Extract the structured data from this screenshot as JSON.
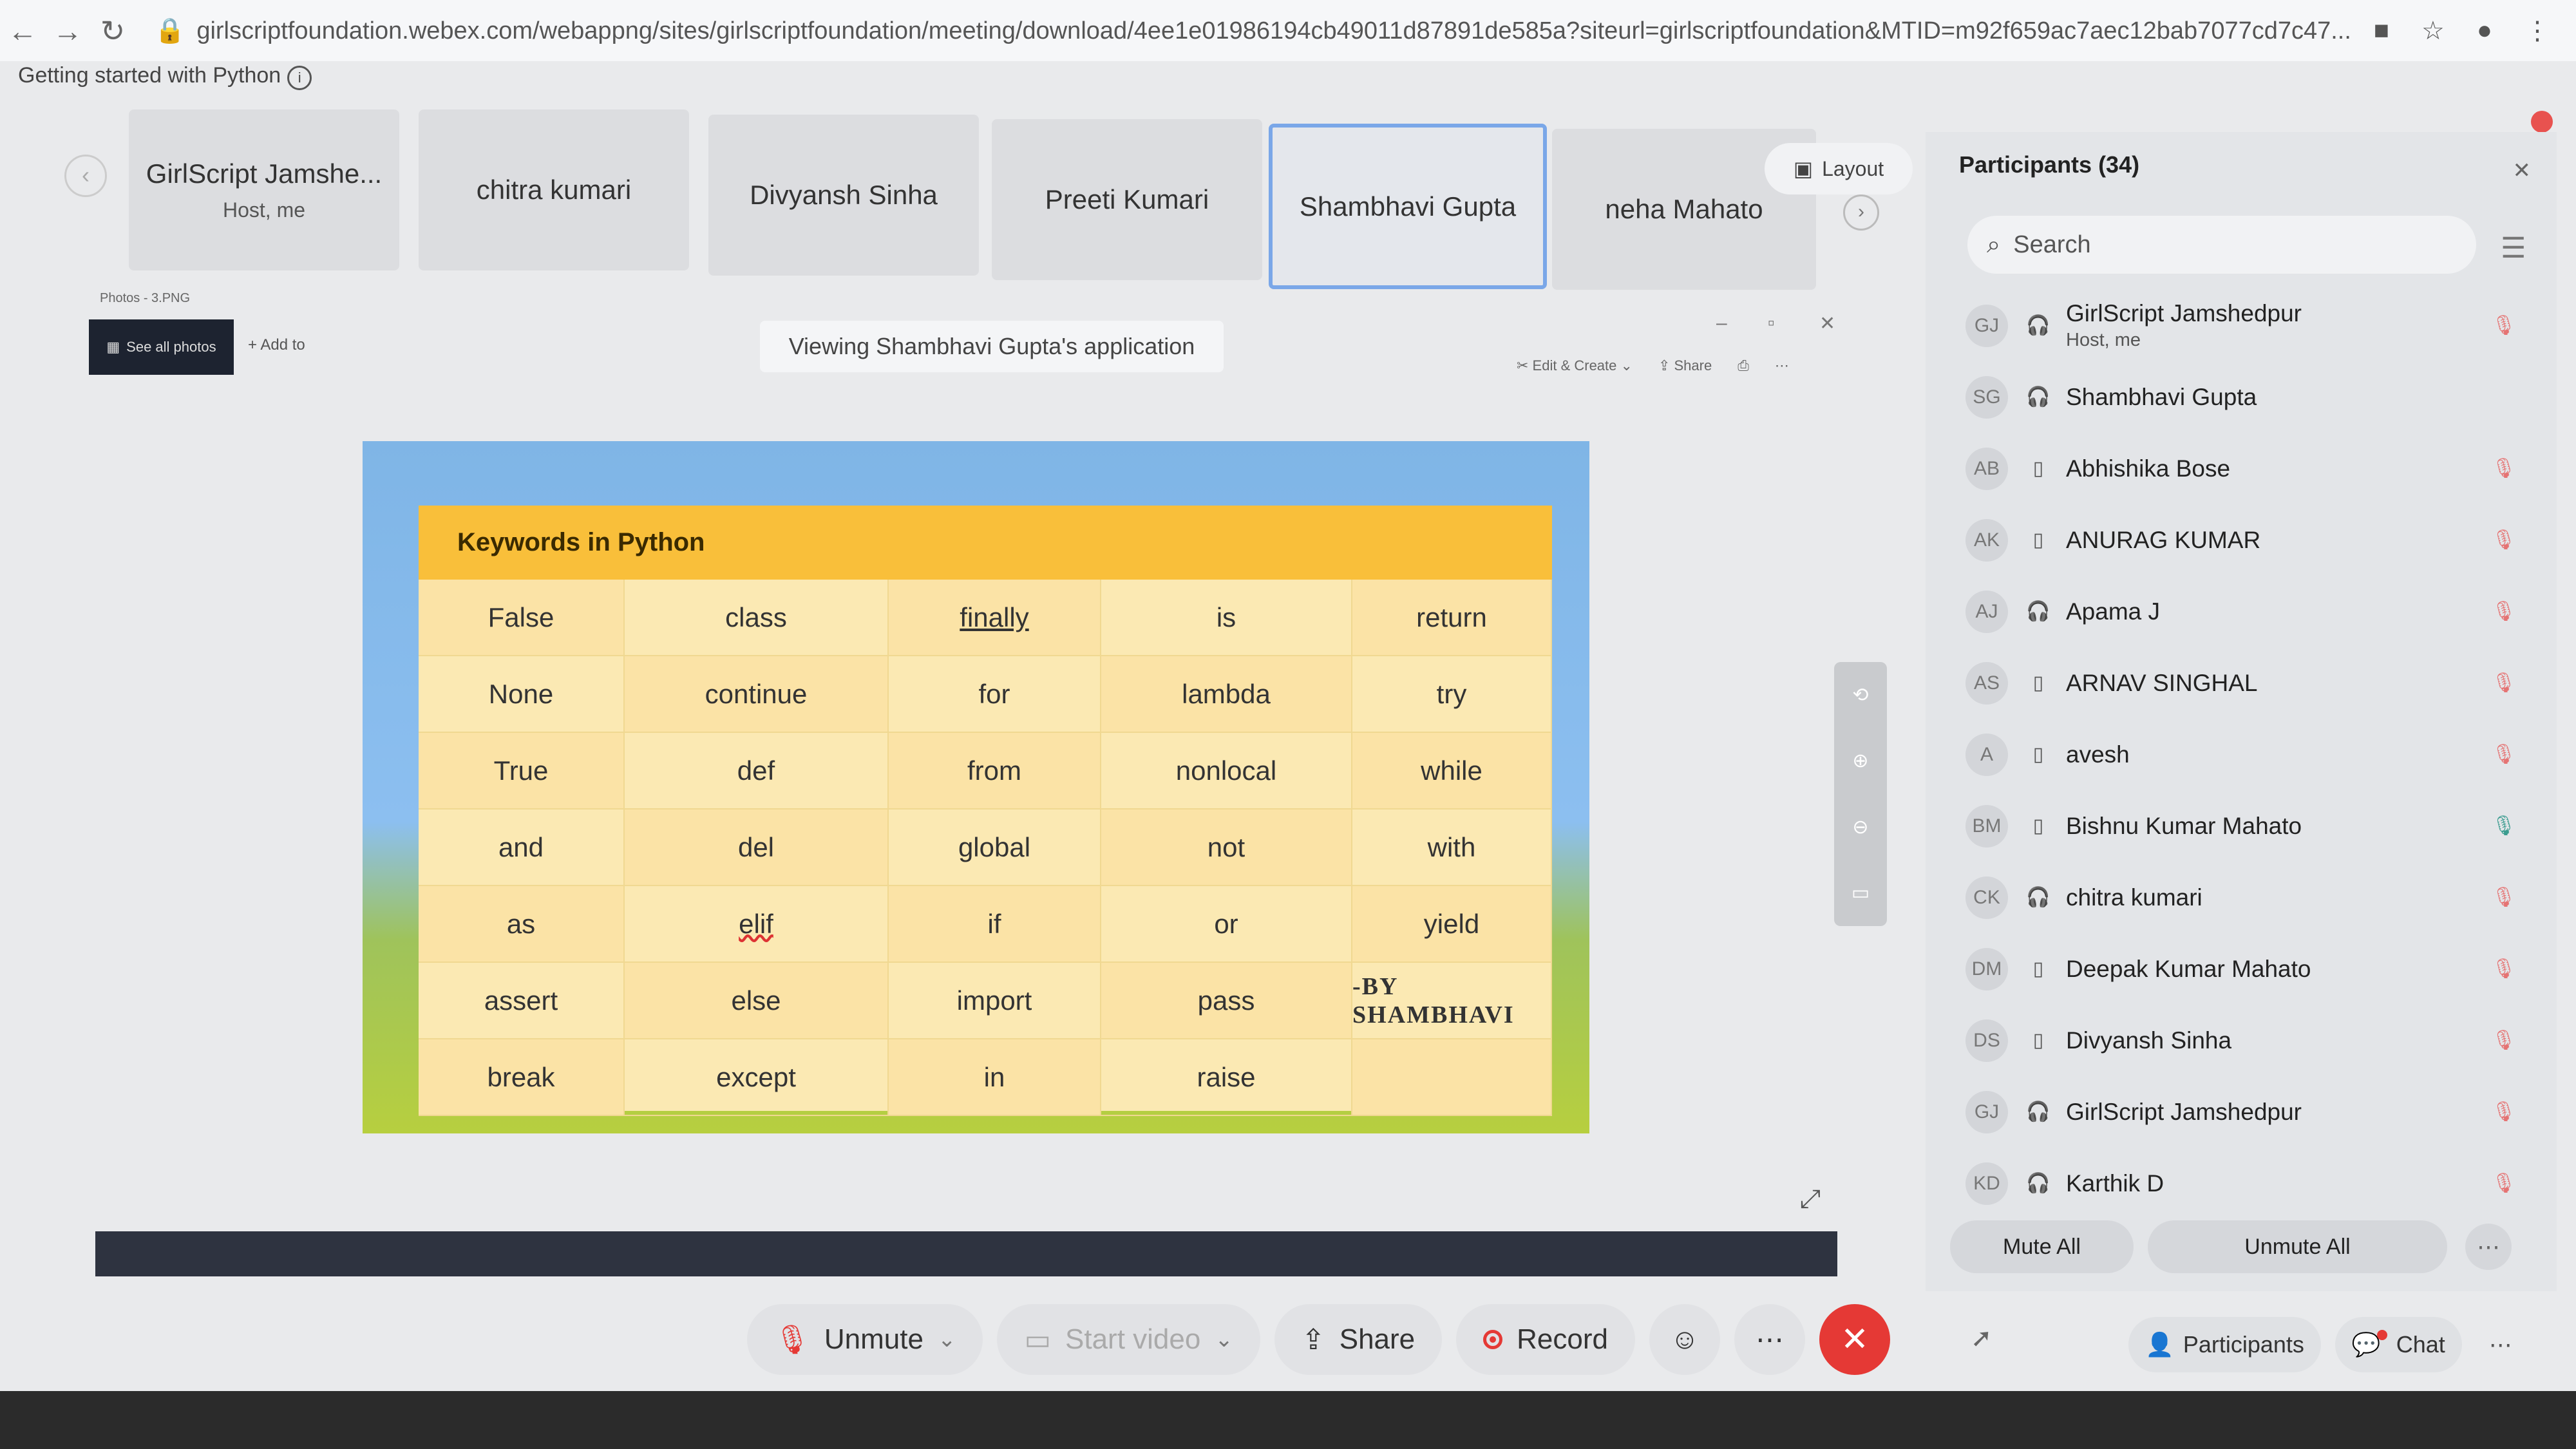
{
  "browser": {
    "url": "girlscriptfoundation.webex.com/webappng/sites/girlscriptfoundation/meeting/download/4ee1e01986194cb49011d87891de585a?siteurl=girlscriptfoundation&MTID=m92f659ac7aec12bab7077cd7c47..."
  },
  "meeting": {
    "title": "Getting started with Python"
  },
  "video_tiles": [
    {
      "name": "GirlScript Jamshe...",
      "sub": "Host, me"
    },
    {
      "name": "chitra kumari",
      "sub": ""
    },
    {
      "name": "Divyansh Sinha",
      "sub": ""
    },
    {
      "name": "Preeti Kumari",
      "sub": ""
    },
    {
      "name": "Shambhavi Gupta",
      "sub": ""
    },
    {
      "name": "neha Mahato",
      "sub": ""
    }
  ],
  "layout_label": "Layout",
  "share": {
    "viewing_label": "Viewing Shambhavi Gupta's application",
    "photos_title": "Photos - 3.PNG",
    "see_all_photos": "See all photos",
    "add_to": "Add to",
    "edit_create": "Edit & Create",
    "share": "Share"
  },
  "keywords_table": {
    "title": "Keywords in Python",
    "rows": [
      [
        "False",
        "class",
        "finally",
        "is",
        "return"
      ],
      [
        "None",
        "continue",
        "for",
        "lambda",
        "try"
      ],
      [
        "True",
        "def",
        "from",
        "nonlocal",
        "while"
      ],
      [
        "and",
        "del",
        "global",
        "not",
        "with"
      ],
      [
        "as",
        "elif",
        "if",
        "or",
        "yield"
      ],
      [
        "assert",
        "else",
        "import",
        "pass",
        "-BY SHAMBHAVI"
      ],
      [
        "break",
        "except",
        "in",
        "raise",
        ""
      ]
    ]
  },
  "controls": {
    "unmute": "Unmute",
    "start_video": "Start video",
    "share": "Share",
    "record": "Record"
  },
  "participants": {
    "title": "Participants (34)",
    "search_placeholder": "Search",
    "list": [
      {
        "initials": "GJ",
        "name": "GirlScript Jamshedpur",
        "sub": "Host, me",
        "device": "headset",
        "mic": "muted"
      },
      {
        "initials": "SG",
        "name": "Shambhavi Gupta",
        "sub": "",
        "device": "headset",
        "mic": "none"
      },
      {
        "initials": "AB",
        "name": "Abhishika Bose",
        "sub": "",
        "device": "phone",
        "mic": "muted"
      },
      {
        "initials": "AK",
        "name": "ANURAG KUMAR",
        "sub": "",
        "device": "phone",
        "mic": "muted"
      },
      {
        "initials": "AJ",
        "name": "Apama J",
        "sub": "",
        "device": "headset",
        "mic": "muted"
      },
      {
        "initials": "AS",
        "name": "ARNAV SINGHAL",
        "sub": "",
        "device": "phone",
        "mic": "muted"
      },
      {
        "initials": "A",
        "name": "avesh",
        "sub": "",
        "device": "phone",
        "mic": "muted"
      },
      {
        "initials": "BM",
        "name": "Bishnu Kumar Mahato",
        "sub": "",
        "device": "phone",
        "mic": "on"
      },
      {
        "initials": "CK",
        "name": "chitra kumari",
        "sub": "",
        "device": "headset",
        "mic": "muted"
      },
      {
        "initials": "DM",
        "name": "Deepak Kumar Mahato",
        "sub": "",
        "device": "phone",
        "mic": "muted"
      },
      {
        "initials": "DS",
        "name": "Divyansh Sinha",
        "sub": "",
        "device": "phone",
        "mic": "muted"
      },
      {
        "initials": "GJ",
        "name": "GirlScript Jamshedpur",
        "sub": "",
        "device": "headset",
        "mic": "muted"
      },
      {
        "initials": "KD",
        "name": "Karthik D",
        "sub": "",
        "device": "headset",
        "mic": "muted"
      }
    ],
    "mute_all": "Mute All",
    "unmute_all": "Unmute All"
  },
  "bottom_right": {
    "participants": "Participants",
    "chat": "Chat"
  }
}
